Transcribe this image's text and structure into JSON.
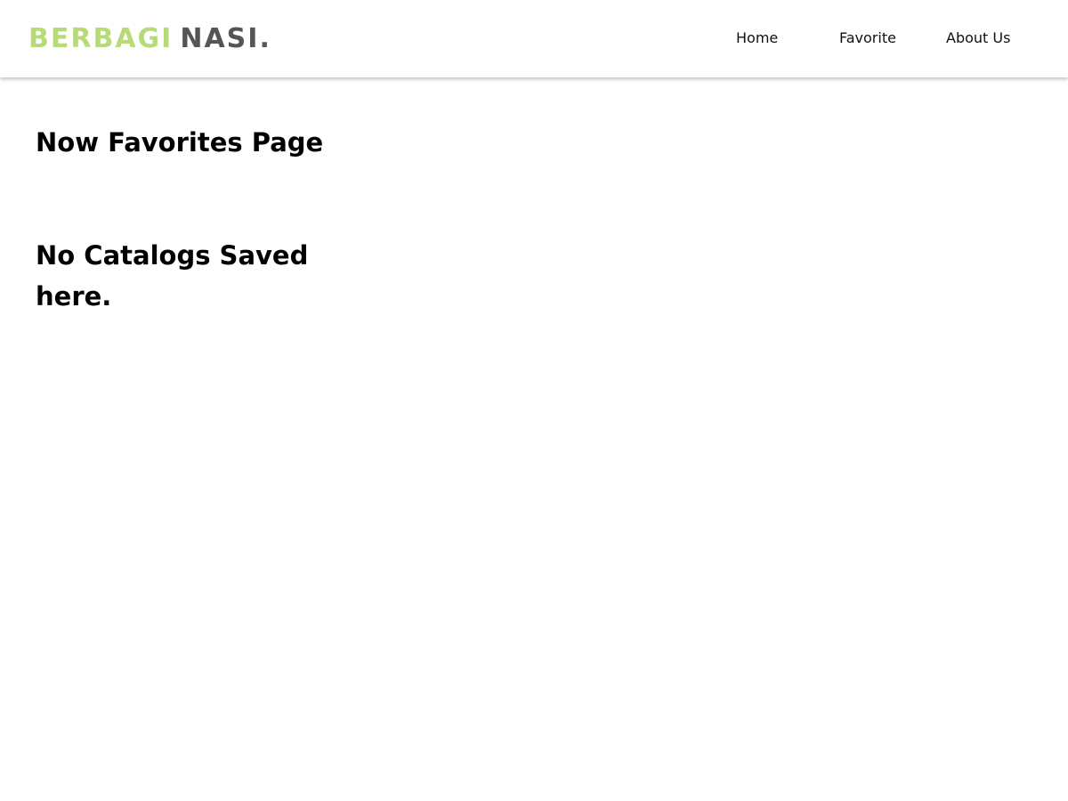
{
  "header": {
    "brand": {
      "part1": "BERBAGI",
      "part2": "NASI.",
      "colors": {
        "part1": "#b8db7a",
        "part2": "#555555"
      }
    },
    "nav": {
      "items": [
        {
          "label": "Home"
        },
        {
          "label": "Favorite"
        },
        {
          "label": "About Us"
        }
      ]
    }
  },
  "main": {
    "title": "Now Favorites Page",
    "empty_message": "No Catalogs Saved here."
  }
}
